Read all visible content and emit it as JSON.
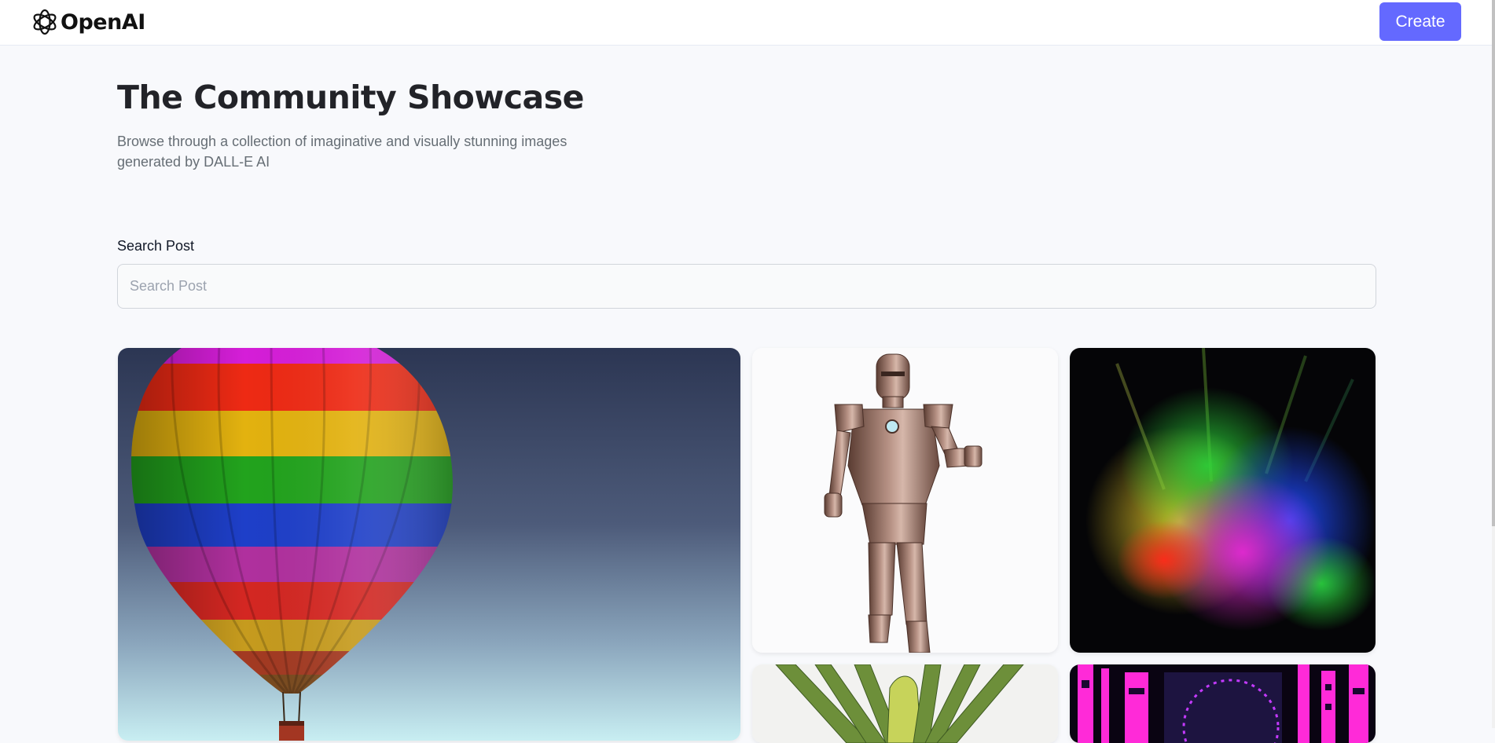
{
  "header": {
    "logo_text": "OpenAI",
    "logo_icon": "openai-logo-icon",
    "create_label": "Create"
  },
  "hero": {
    "title": "The Community Showcase",
    "subtitle": "Browse through a collection of imaginative and visually stunning images generated by DALL-E AI"
  },
  "search": {
    "label": "Search Post",
    "placeholder": "Search Post",
    "value": ""
  },
  "gallery": {
    "cards": [
      {
        "subject": "hot-air-balloon"
      },
      {
        "subject": "metal-robot"
      },
      {
        "subject": "color-powder-explosion"
      },
      {
        "subject": "green-plant-leaves"
      },
      {
        "subject": "neon-city"
      }
    ]
  },
  "colors": {
    "accent": "#6469ff",
    "background": "#f8f9fc",
    "title": "#222328",
    "subtitle": "#666e75"
  }
}
